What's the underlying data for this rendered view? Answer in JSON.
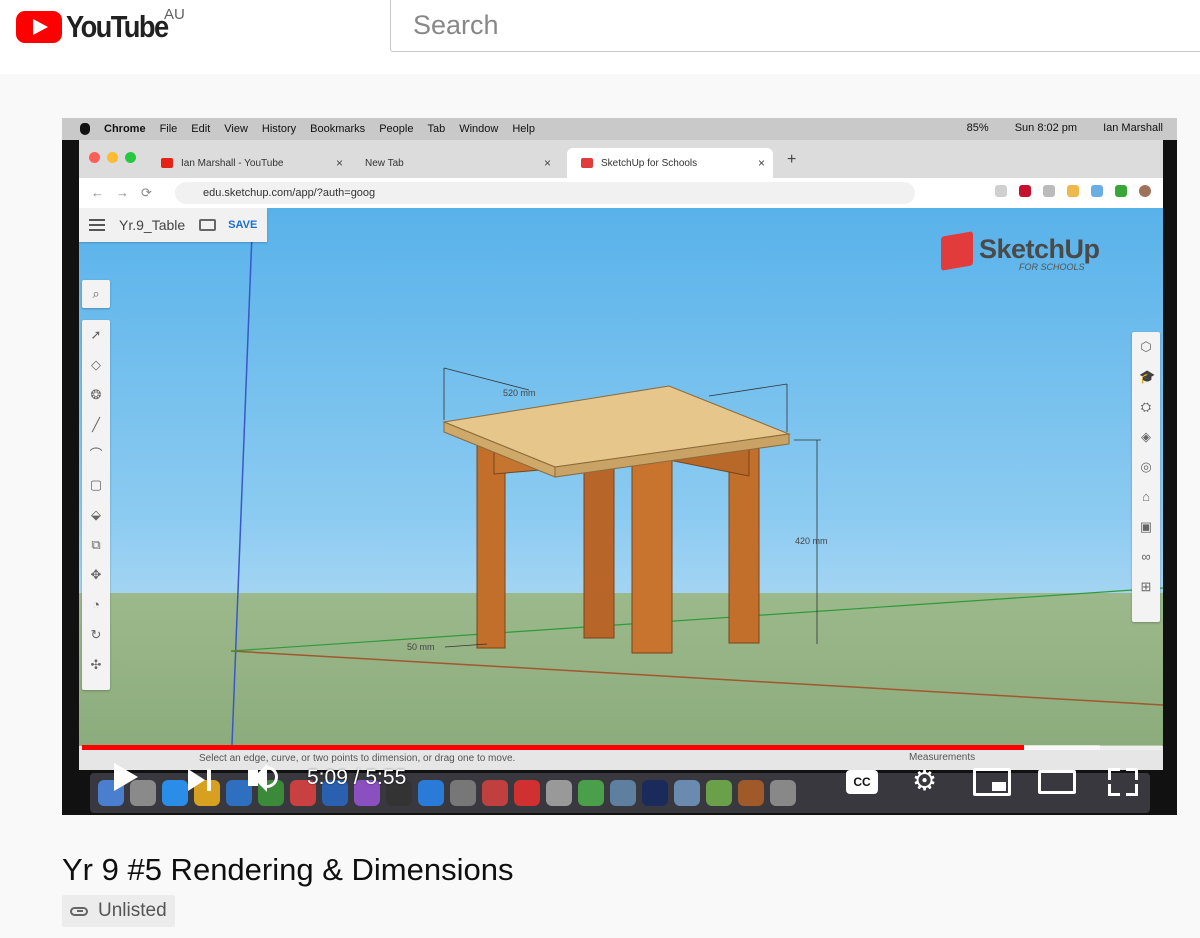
{
  "youtube": {
    "logo_text": "YouTube",
    "country": "AU",
    "search_placeholder": "Search"
  },
  "video_frame": {
    "mac_menu": [
      "Chrome",
      "File",
      "Edit",
      "View",
      "History",
      "Bookmarks",
      "People",
      "Tab",
      "Window",
      "Help"
    ],
    "mac_status": {
      "battery": "85%",
      "clock": "Sun 8:02 pm",
      "user": "Ian Marshall"
    },
    "browser_tabs": [
      {
        "label": "Ian Marshall - YouTube",
        "favicon_color": "#e62117"
      },
      {
        "label": "New Tab",
        "favicon_color": "#dedede"
      },
      {
        "label": "SketchUp for Schools",
        "favicon_color": "#e23b3b"
      }
    ],
    "url": "edu.sketchup.com/app/?auth=goog",
    "sketchup": {
      "file_name": "Yr.9_Table",
      "save_label": "SAVE",
      "logo": "SketchUp",
      "logo_sub": "FOR SCHOOLS",
      "dim_width": "520 mm",
      "dim_height": "420 mm",
      "dim_leg": "50 mm",
      "status_hint": "Select an edge, curve, or two points to dimension, or drag one to move.",
      "measurements_label": "Measurements"
    }
  },
  "player": {
    "current_time": "5:09",
    "duration": "5:55",
    "time_display": "5:09 / 5:55",
    "progress": 0.872,
    "buffered": 0.943,
    "cc_label": "CC"
  },
  "video": {
    "title": "Yr 9 #5 Rendering & Dimensions",
    "visibility": "Unlisted"
  }
}
